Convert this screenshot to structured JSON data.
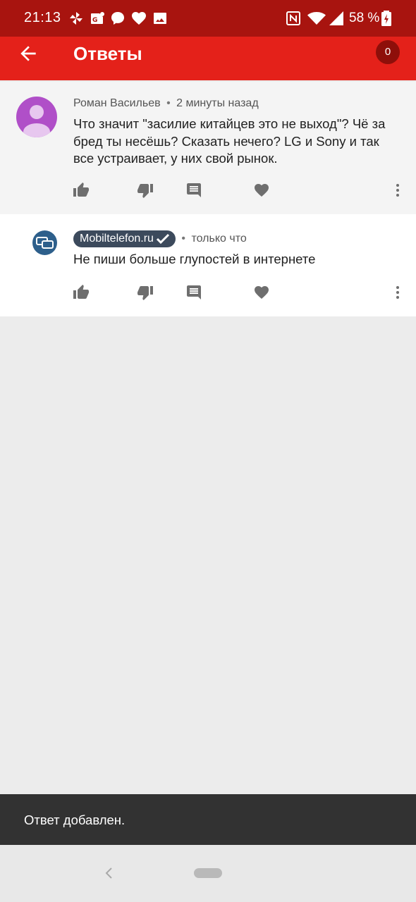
{
  "status_bar": {
    "time": "21:13",
    "battery": "58 %",
    "icons": [
      "pinwheel-icon",
      "gboard-icon",
      "chat-bubble-icon",
      "heart-icon",
      "image-icon",
      "nfc-icon",
      "wifi-icon",
      "signal-icon",
      "battery-icon"
    ]
  },
  "app_bar": {
    "title": "Ответы",
    "counter": "0",
    "back_icon": "arrow-back-icon"
  },
  "comments": [
    {
      "author": "Роман Васильев",
      "separator": "•",
      "time": "2 минуты назад",
      "text": "Что значит \"засилие китайцев это не выход\"? Чё за бред ты несёшь? Сказать нечего? LG и Sony и так все устраивает, у них свой рынок.",
      "avatar": "default-user-avatar"
    },
    {
      "author": "Mobiltelefon.ru",
      "verified": true,
      "separator": "•",
      "time": "только что",
      "text": "Не пиши больше глупостей в интернете",
      "avatar": "brand-avatar"
    }
  ],
  "actions": [
    "thumb-up-icon",
    "thumb-down-icon",
    "reply-comment-icon",
    "heart-icon",
    "more-vert-icon"
  ],
  "snackbar": {
    "message": "Ответ добавлен."
  },
  "nav_bar": {
    "back": "nav-back-icon",
    "home": "home-pill"
  },
  "colors": {
    "status_bar": "#a8140f",
    "app_bar": "#e4211a",
    "counter_bg": "#8e0f0a",
    "avatar_user": "#b04fc8",
    "avatar_brand": "#2d5f8b",
    "badge_bg": "#3c4a5c",
    "snackbar_bg": "#323232",
    "action_icon": "#6e6e6e"
  }
}
